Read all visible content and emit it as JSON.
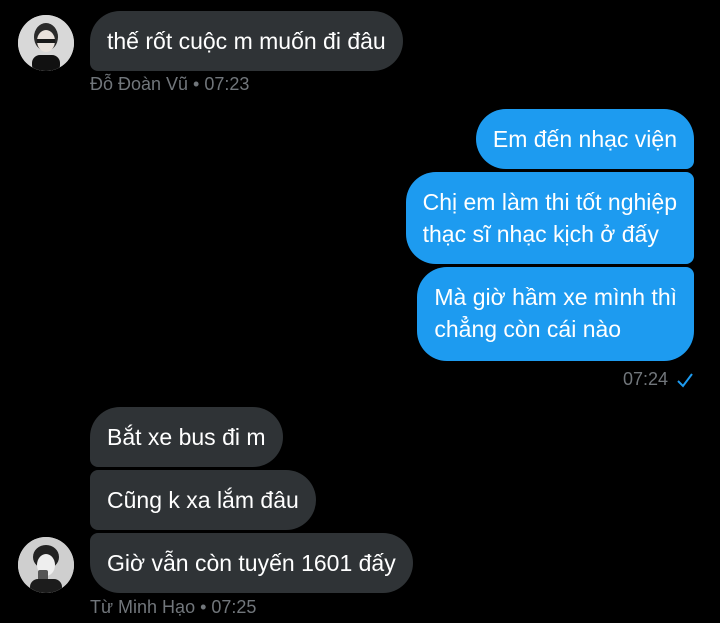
{
  "colors": {
    "background": "#000000",
    "incoming_bubble": "#2f3336",
    "outgoing_bubble": "#1d9bf0",
    "meta_text": "#71767b",
    "check": "#1d9bf0"
  },
  "group1": {
    "messages": [
      "thế rốt cuộc m muốn đi đâu"
    ],
    "sender_meta": "Đỗ Đoàn Vũ • 07:23",
    "avatar_icon": "user-avatar"
  },
  "group2": {
    "messages": [
      "Em đến nhạc viện",
      "Chị em làm thi tốt nghiệp\nthạc sĩ nhạc kịch ở đấy",
      "Mà giờ hầm xe mình thì\nchẳng còn cái nào"
    ],
    "time": "07:24",
    "status_icon": "check-icon"
  },
  "group3": {
    "messages": [
      "Bắt xe bus đi m",
      "Cũng k xa lắm đâu",
      "Giờ vẫn còn tuyến 1601 đấy"
    ],
    "sender_meta": "Từ Minh Hạo • 07:25",
    "avatar_icon": "user-avatar"
  }
}
